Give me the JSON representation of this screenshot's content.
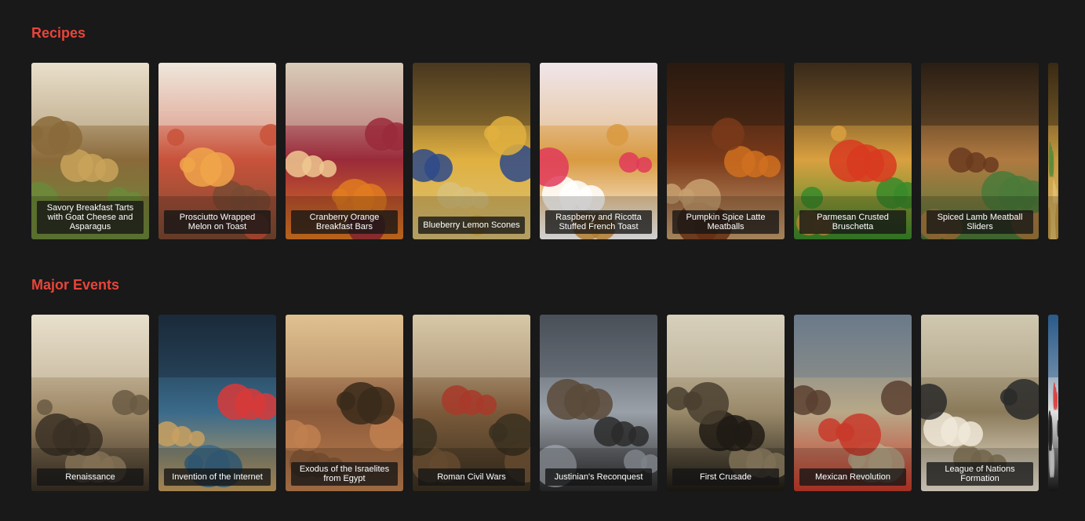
{
  "sections": [
    {
      "title": "Recipes",
      "cards": [
        {
          "title": "Savory Breakfast Tarts with Goat Cheese and Asparagus",
          "image": "breakfast-tarts-image",
          "palette": [
            "#e9dfcb",
            "#8a6a3a",
            "#c9a35a",
            "#6b8a3a"
          ]
        },
        {
          "title": "Prosciutto Wrapped Melon on Toast",
          "image": "prosciutto-melon-image",
          "palette": [
            "#efe7dc",
            "#c9523a",
            "#f0a64a",
            "#7a4a32"
          ]
        },
        {
          "title": "Cranberry Orange Breakfast Bars",
          "image": "cranberry-bars-image",
          "palette": [
            "#d9cdb8",
            "#9a2a3a",
            "#f0c890",
            "#e07a20"
          ]
        },
        {
          "title": "Blueberry Lemon Scones",
          "image": "blueberry-scones-image",
          "palette": [
            "#4a3820",
            "#e0b040",
            "#2e4a8a",
            "#d9c27a"
          ]
        },
        {
          "title": "Raspberry and Ricotta Stuffed French Toast",
          "image": "french-toast-image",
          "palette": [
            "#f0e6ea",
            "#d99a40",
            "#e03a5a",
            "#ffffff"
          ]
        },
        {
          "title": "Pumpkin Spice Latte Meatballs",
          "image": "pumpkin-meatballs-image",
          "palette": [
            "#2a1a10",
            "#7a3a1a",
            "#d07020",
            "#c8a070"
          ]
        },
        {
          "title": "Parmesan Crusted Bruschetta",
          "image": "bruschetta-image",
          "palette": [
            "#3a2a1a",
            "#d9a040",
            "#d83a20",
            "#3a8a2a"
          ]
        },
        {
          "title": "Spiced Lamb Meatball Sliders",
          "image": "lamb-sliders-image",
          "palette": [
            "#2a1e14",
            "#b07a40",
            "#6a3a20",
            "#4a7a3a"
          ]
        },
        {
          "title": "",
          "image": "partial-card-image",
          "palette": [
            "#3a2a14",
            "#c89a40",
            "#5a8a3a",
            "#e0c070"
          ]
        }
      ]
    },
    {
      "title": "Major Events",
      "cards": [
        {
          "title": "Renaissance",
          "image": "renaissance-image",
          "palette": [
            "#e8e0cc",
            "#a08a68",
            "#6a5a44",
            "#3a3024"
          ]
        },
        {
          "title": "Invention of the Internet",
          "image": "internet-image",
          "palette": [
            "#1a2a3a",
            "#3a6a8a",
            "#d83a3a",
            "#c8a060"
          ]
        },
        {
          "title": "Exodus of the Israelites from Egypt",
          "image": "exodus-image",
          "palette": [
            "#e0c090",
            "#8a5a3a",
            "#3a2a1a",
            "#c08050"
          ]
        },
        {
          "title": "Roman Civil Wars",
          "image": "roman-civil-wars-image",
          "palette": [
            "#d8c8a8",
            "#7a5a3a",
            "#a83a2a",
            "#3a3020"
          ]
        },
        {
          "title": "Justinian's Reconquest",
          "image": "justinian-image",
          "palette": [
            "#4a5058",
            "#9aa0a8",
            "#5a4a3a",
            "#2a2a2a"
          ]
        },
        {
          "title": "First Crusade",
          "image": "first-crusade-image",
          "palette": [
            "#d8d0bc",
            "#9a8a6a",
            "#4a4030",
            "#1e1a14"
          ]
        },
        {
          "title": "Mexican Revolution",
          "image": "mexican-revolution-image",
          "palette": [
            "#6a7a8a",
            "#b8a888",
            "#5a4030",
            "#c83a2a"
          ]
        },
        {
          "title": "League of Nations Formation",
          "image": "league-of-nations-image",
          "palette": [
            "#d0c8b0",
            "#8a7a5a",
            "#2a2a2a",
            "#f0e8d8"
          ]
        },
        {
          "title": "",
          "image": "partial-card-image",
          "palette": [
            "#2a5a8a",
            "#e0e0e0",
            "#d83a3a",
            "#1a1a1a"
          ]
        }
      ]
    }
  ]
}
